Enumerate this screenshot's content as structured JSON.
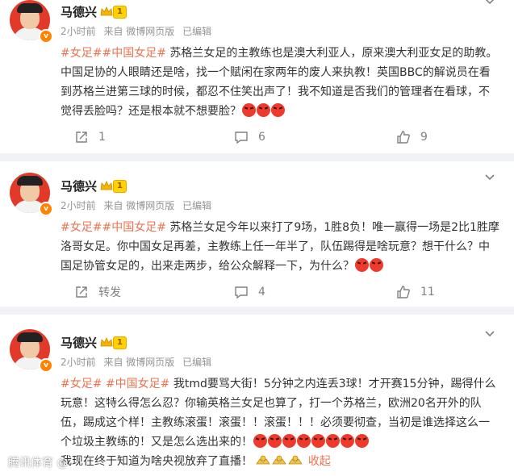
{
  "posts": [
    {
      "author": "马德兴",
      "level": "1",
      "time": "2小时前",
      "source": "来自 微博网页版",
      "edited": "已编辑",
      "tags": "#女足##中国女足#",
      "text": " 苏格兰女足的主教练也是澳大利亚人，原来澳大利亚女足的助教。中国足协的人眼睛还是啥，找一个赋闲在家两年的废人来执教！英国BBC的解说员在看到苏格兰进第三球的时候，都忍不住笑出声了！我不知道是否我们的管理者在看球，不觉得丢脸吗？还是根本就不想要脸？",
      "emoji_count": 3,
      "repost": "1",
      "comments": "6",
      "likes": "9"
    },
    {
      "author": "马德兴",
      "level": "1",
      "time": "2小时前",
      "source": "来自 微博网页版",
      "edited": "已编辑",
      "tags": "#女足##中国女足#",
      "text": " 苏格兰女足今年以来打了9场，1胜8负！唯一赢得一场是2比1胜摩洛哥女足。你中国女足再差，主教练上任一年半了，队伍踢得是啥玩意？想干什么？中国足协管女足的，出来走两步，给公众解释一下，为什么？",
      "emoji_count": 2,
      "repost": "转发",
      "comments": "4",
      "likes": "11"
    },
    {
      "author": "马德兴",
      "level": "1",
      "time": "2小时前",
      "source": "来自 微博网页版",
      "edited": "已编辑",
      "tags": "#女足# #中国女足#",
      "text": " 我tmd要骂大街！5分钟之内连丢3球！才开赛15分钟，踢得什么玩意！这特么得怎么忍？你输英格兰女足也算了，打一个苏格兰，欧洲20名开外的队伍，踢成这个样！主教练滚蛋！滚蛋！！滚蛋！！！必须要彻查，当初是谁选择这么一个垃圾主教练的！又是怎么选出来的！",
      "emoji_count": 8,
      "text2": "我现在终于知道为啥央视放弃了直播！",
      "collapse": "收起"
    }
  ],
  "watermark": "腾讯体育 @"
}
